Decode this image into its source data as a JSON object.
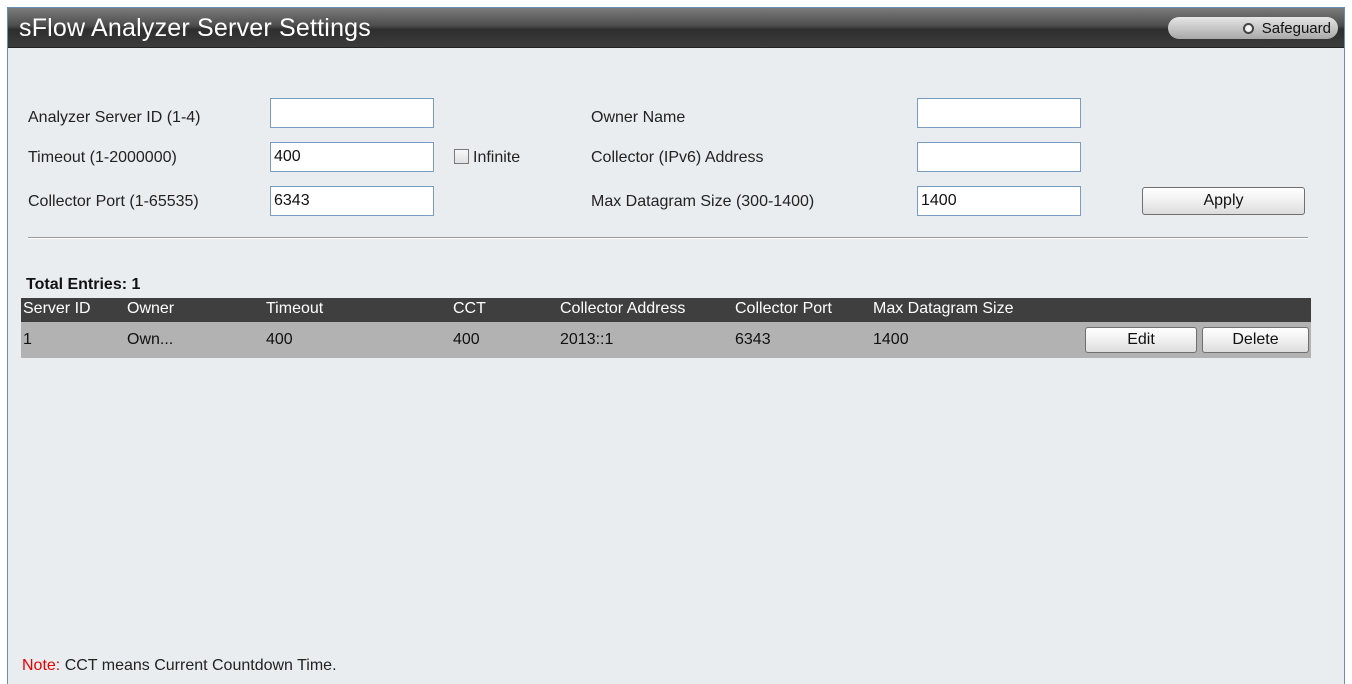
{
  "header": {
    "title": "sFlow Analyzer Server Settings",
    "safeguard_label": "Safeguard"
  },
  "form": {
    "server_id": {
      "label": "Analyzer Server ID (1-4)",
      "value": ""
    },
    "timeout": {
      "label": "Timeout (1-2000000)",
      "value": "400"
    },
    "infinite": {
      "label": "Infinite",
      "checked": false
    },
    "collector_port": {
      "label": "Collector Port (1-65535)",
      "value": "6343"
    },
    "owner_name": {
      "label": "Owner Name",
      "value": ""
    },
    "collector_address": {
      "label": "Collector (IPv6) Address",
      "value": ""
    },
    "max_datagram": {
      "label": "Max Datagram Size (300-1400)",
      "value": "1400"
    },
    "apply_label": "Apply"
  },
  "table": {
    "total_label": "Total Entries: 1",
    "headers": [
      "Server ID",
      "Owner",
      "Timeout",
      "CCT",
      "Collector Address",
      "Collector Port",
      "Max Datagram Size"
    ],
    "rows": [
      {
        "cells": [
          "1",
          "Own...",
          "400",
          "400",
          "2013::1",
          "6343",
          "1400"
        ],
        "edit_label": "Edit",
        "delete_label": "Delete"
      }
    ]
  },
  "note": {
    "prefix": "Note:",
    "text": " CCT means Current Countdown Time."
  },
  "colors": {
    "note_prefix": "#e60000",
    "header_bar": "#3f3f3f",
    "row_bg": "#b2b2b2",
    "frame_bg": "#eaedf0"
  }
}
